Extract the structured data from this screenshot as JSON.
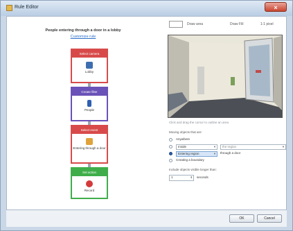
{
  "window": {
    "title": "Rule Editor",
    "close_label": "×"
  },
  "flow": {
    "title": "People entering through a door in a lobby",
    "customize_link": "Customize rule",
    "blocks": [
      {
        "head": "Select camera",
        "label": "Lobby",
        "color": "#d84a4a",
        "icon_color": "#3d6fb0"
      },
      {
        "head": "Create filter",
        "label": "People",
        "color": "#6a52b8",
        "icon_color": "#2f5fb0"
      },
      {
        "head": "Select event",
        "label": "Entering through a door",
        "color": "#d84a4a",
        "icon_color": "#e0a33a"
      },
      {
        "head": "Set action",
        "label": "Record",
        "color": "#3fae4a",
        "icon_color": "#d43a3a"
      }
    ]
  },
  "toolbar": {
    "draw_label": "Draw area",
    "mode_label": "Draw Fill",
    "zoom_label": "1:1 pixel"
  },
  "preview": {
    "caption": "Click and drag the cursor to outline an area"
  },
  "options": {
    "section_label": "Moving objects that are:",
    "rows": [
      {
        "label": "Anywhere",
        "selected": false
      },
      {
        "label": "Inside",
        "selected": false,
        "dropdown": "",
        "suffix": "the region"
      },
      {
        "label": "Entering region",
        "selected": true,
        "dropdown": "",
        "suffix": "through a door"
      },
      {
        "label": "Creating a boundary",
        "selected": false
      }
    ],
    "visible_label": "Include objects visible longer than:",
    "visible_value": "1",
    "visible_unit": "seconds"
  },
  "buttons": {
    "ok": "OK",
    "cancel": "Cancel"
  }
}
